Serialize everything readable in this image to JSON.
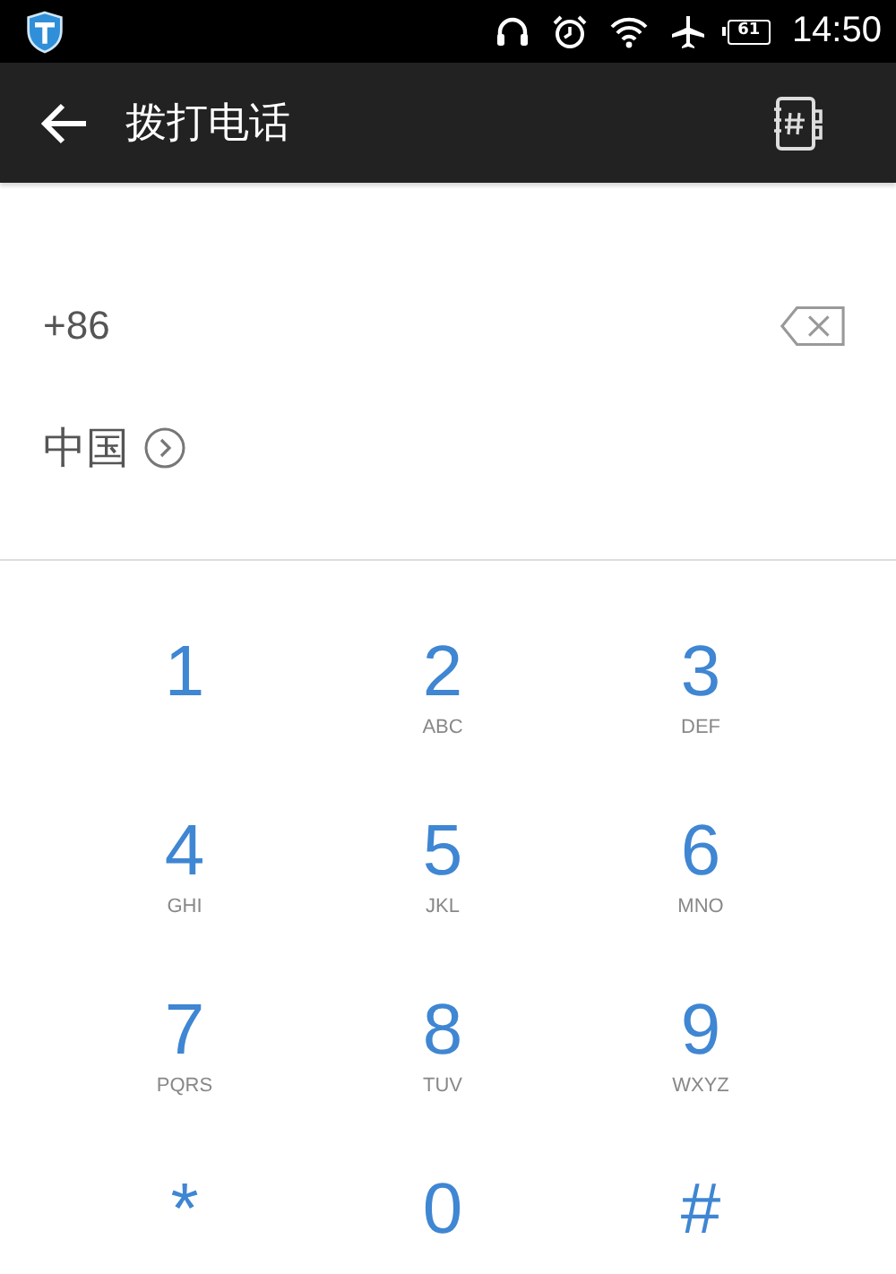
{
  "status_bar": {
    "battery": "61",
    "time": "14:50"
  },
  "app_bar": {
    "title": "拨打电话"
  },
  "number_field": {
    "value": "+86"
  },
  "country": {
    "label": "中国"
  },
  "keypad": [
    {
      "digit": "1"
    },
    {
      "digit": "2",
      "letters": "ABC"
    },
    {
      "digit": "3",
      "letters": "DEF"
    },
    {
      "digit": "4",
      "letters": "GHI"
    },
    {
      "digit": "5",
      "letters": "JKL"
    },
    {
      "digit": "6",
      "letters": "MNO"
    },
    {
      "digit": "7",
      "letters": "PQRS"
    },
    {
      "digit": "8",
      "letters": "TUV"
    },
    {
      "digit": "9",
      "letters": "WXYZ"
    },
    {
      "digit": "*"
    },
    {
      "digit": "0"
    },
    {
      "digit": "#"
    }
  ]
}
